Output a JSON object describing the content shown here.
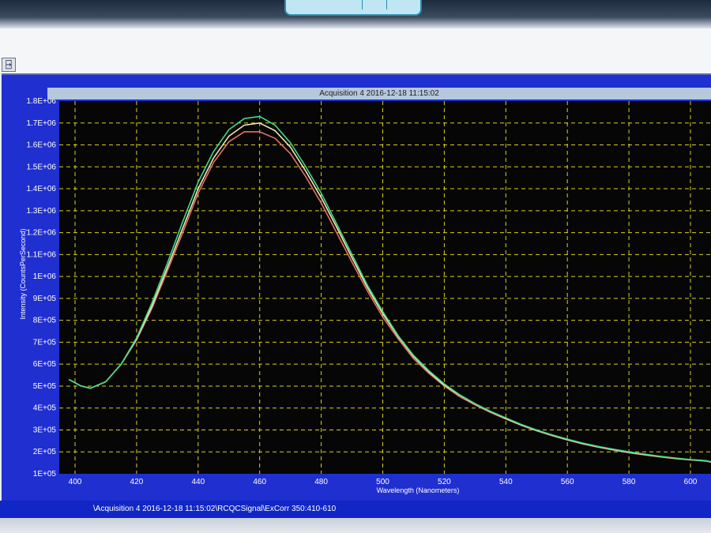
{
  "window": {
    "toolbar_icon": "⍈",
    "chart_title": "Acquisition 4 2016-12-18 11:15:02",
    "status_text": "\\Acquisition 4 2016-12-18 11:15:02\\RCQCSignal\\ExCorr 350:410-610"
  },
  "colors": {
    "panel": "#1f2fd0",
    "plot_background": "#060606",
    "grid": "#d6d21e",
    "axis_text": "#ffffff"
  },
  "chart_data": {
    "type": "line",
    "title": "Acquisition 4 2016-12-18 11:15:02",
    "xlabel": "Wavelength (Nanometers)",
    "ylabel": "Intensity (CountsPerSecond)",
    "xlim": [
      400,
      610
    ],
    "ylim": [
      100000,
      1800000
    ],
    "x_ticks": [
      "400",
      "420",
      "440",
      "460",
      "480",
      "500",
      "520",
      "540",
      "560",
      "580",
      "600"
    ],
    "y_ticks": [
      "1E+05",
      "2E+05",
      "3E+05",
      "4E+05",
      "5E+05",
      "6E+05",
      "7E+05",
      "8E+05",
      "9E+05",
      "1E+06",
      "1.1E+06",
      "1.2E+06",
      "1.3E+06",
      "1.4E+06",
      "1.5E+06",
      "1.6E+06",
      "1.7E+06",
      "1.8E+06"
    ],
    "grid": true,
    "legend": "none",
    "x": [
      398,
      402,
      405,
      410,
      415,
      420,
      425,
      430,
      435,
      440,
      445,
      450,
      455,
      460,
      465,
      470,
      475,
      480,
      485,
      490,
      495,
      500,
      505,
      510,
      515,
      520,
      525,
      530,
      535,
      540,
      545,
      550,
      555,
      560,
      565,
      570,
      575,
      580,
      585,
      590,
      595,
      600,
      605,
      610
    ],
    "series": [
      {
        "color": "#3ddc8a",
        "values": [
          530000,
          500000,
          490000,
          520000,
          600000,
          720000,
          880000,
          1060000,
          1250000,
          1430000,
          1570000,
          1670000,
          1720000,
          1730000,
          1690000,
          1610000,
          1500000,
          1380000,
          1240000,
          1100000,
          960000,
          840000,
          730000,
          640000,
          570000,
          510000,
          460000,
          420000,
          385000,
          355000,
          325000,
          300000,
          278000,
          258000,
          240000,
          225000,
          212000,
          200000,
          190000,
          180000,
          172000,
          165000,
          160000,
          155000
        ]
      },
      {
        "color": "#f3e7b0",
        "values": [
          530000,
          500000,
          490000,
          520000,
          600000,
          715000,
          865000,
          1040000,
          1220000,
          1400000,
          1540000,
          1640000,
          1690000,
          1700000,
          1665000,
          1590000,
          1480000,
          1360000,
          1225000,
          1085000,
          950000,
          830000,
          725000,
          635000,
          565000,
          505000,
          458000,
          418000,
          383000,
          352000,
          323000,
          298000,
          276000,
          256000,
          238000,
          223000,
          210000,
          198000,
          188000,
          179000,
          171000,
          164000,
          159000,
          154000
        ]
      },
      {
        "color": "#e8706a",
        "values": [
          530000,
          500000,
          490000,
          520000,
          600000,
          710000,
          855000,
          1025000,
          1200000,
          1380000,
          1520000,
          1615000,
          1660000,
          1660000,
          1630000,
          1560000,
          1455000,
          1335000,
          1200000,
          1065000,
          935000,
          815000,
          715000,
          625000,
          558000,
          500000,
          452000,
          414000,
          380000,
          350000,
          321000,
          296000,
          274000,
          254000,
          236000,
          221000,
          208000,
          196000,
          186000,
          177000,
          169000,
          163000,
          158000,
          153000
        ]
      }
    ]
  }
}
